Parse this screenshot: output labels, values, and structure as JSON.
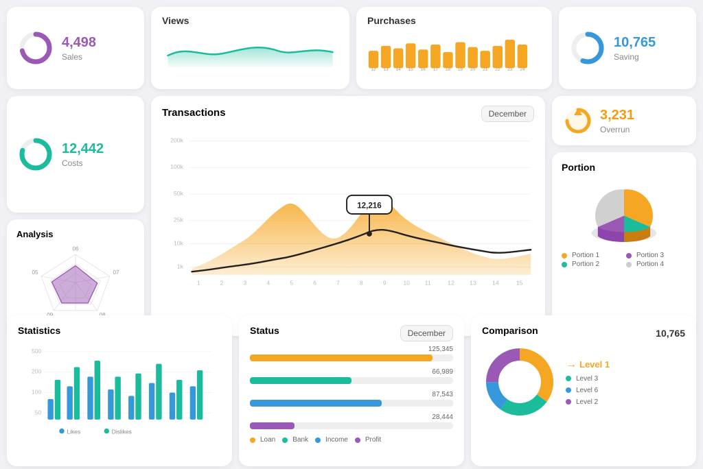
{
  "top": {
    "sales": {
      "value": "4,498",
      "label": "Sales"
    },
    "views": {
      "title": "Views"
    },
    "purchases": {
      "title": "Purchases",
      "x_labels": [
        "12",
        "13",
        "14",
        "15",
        "16",
        "17",
        "18",
        "19",
        "20",
        "21",
        "22",
        "23",
        "24"
      ]
    },
    "saving": {
      "value": "10,765",
      "label": "Saving"
    }
  },
  "middle": {
    "costs": {
      "value": "12,442",
      "label": "Costs"
    },
    "transactions": {
      "title": "Transactions",
      "badge": "December",
      "tooltip_value": "12,216",
      "y_labels": [
        "200k",
        "100k",
        "50k",
        "25k",
        "10k",
        "1k"
      ],
      "x_labels": [
        "1",
        "2",
        "3",
        "4",
        "5",
        "6",
        "7",
        "8",
        "9",
        "10",
        "11",
        "12",
        "13",
        "14",
        "15"
      ]
    },
    "overrun": {
      "value": "3,231",
      "label": "Overrun"
    },
    "analysis": {
      "title": "Analysis",
      "radar_labels": [
        "06",
        "07",
        "08",
        "09",
        "05"
      ]
    },
    "portion": {
      "title": "Portion",
      "legend": [
        {
          "label": "Portion 1",
          "color": "#f5a623"
        },
        {
          "label": "Portion 2",
          "color": "#1abc9c"
        },
        {
          "label": "Portion 3",
          "color": "#9b59b6"
        },
        {
          "label": "Portion 4",
          "color": "#ccc"
        }
      ]
    }
  },
  "bottom": {
    "statistics": {
      "title": "Statistics",
      "y_labels": [
        "500",
        "200",
        "100",
        "50"
      ],
      "legend": [
        {
          "label": "Likes",
          "color": "#3498db"
        },
        {
          "label": "Dislikes",
          "color": "#1abc9c"
        }
      ]
    },
    "status": {
      "title": "Status",
      "badge": "December",
      "bars": [
        {
          "label": "Loan",
          "color": "#f5a623",
          "value": 125345,
          "display": "125,345",
          "pct": 90
        },
        {
          "label": "Bank",
          "color": "#1abc9c",
          "value": 66989,
          "display": "66,989",
          "pct": 50
        },
        {
          "label": "Income",
          "color": "#3498db",
          "value": 87543,
          "display": "87,543",
          "pct": 65
        },
        {
          "label": "Profit",
          "color": "#9b59b6",
          "value": 28444,
          "display": "28,444",
          "pct": 22
        }
      ]
    },
    "comparison": {
      "title": "Comparison",
      "value": "10,765",
      "legend": [
        {
          "label": "Level 1",
          "color": "#f5a623"
        },
        {
          "label": "Level 3",
          "color": "#1abc9c"
        },
        {
          "label": "Level 6",
          "color": "#3498db"
        },
        {
          "label": "Level 2",
          "color": "#9b59b6"
        }
      ]
    }
  }
}
